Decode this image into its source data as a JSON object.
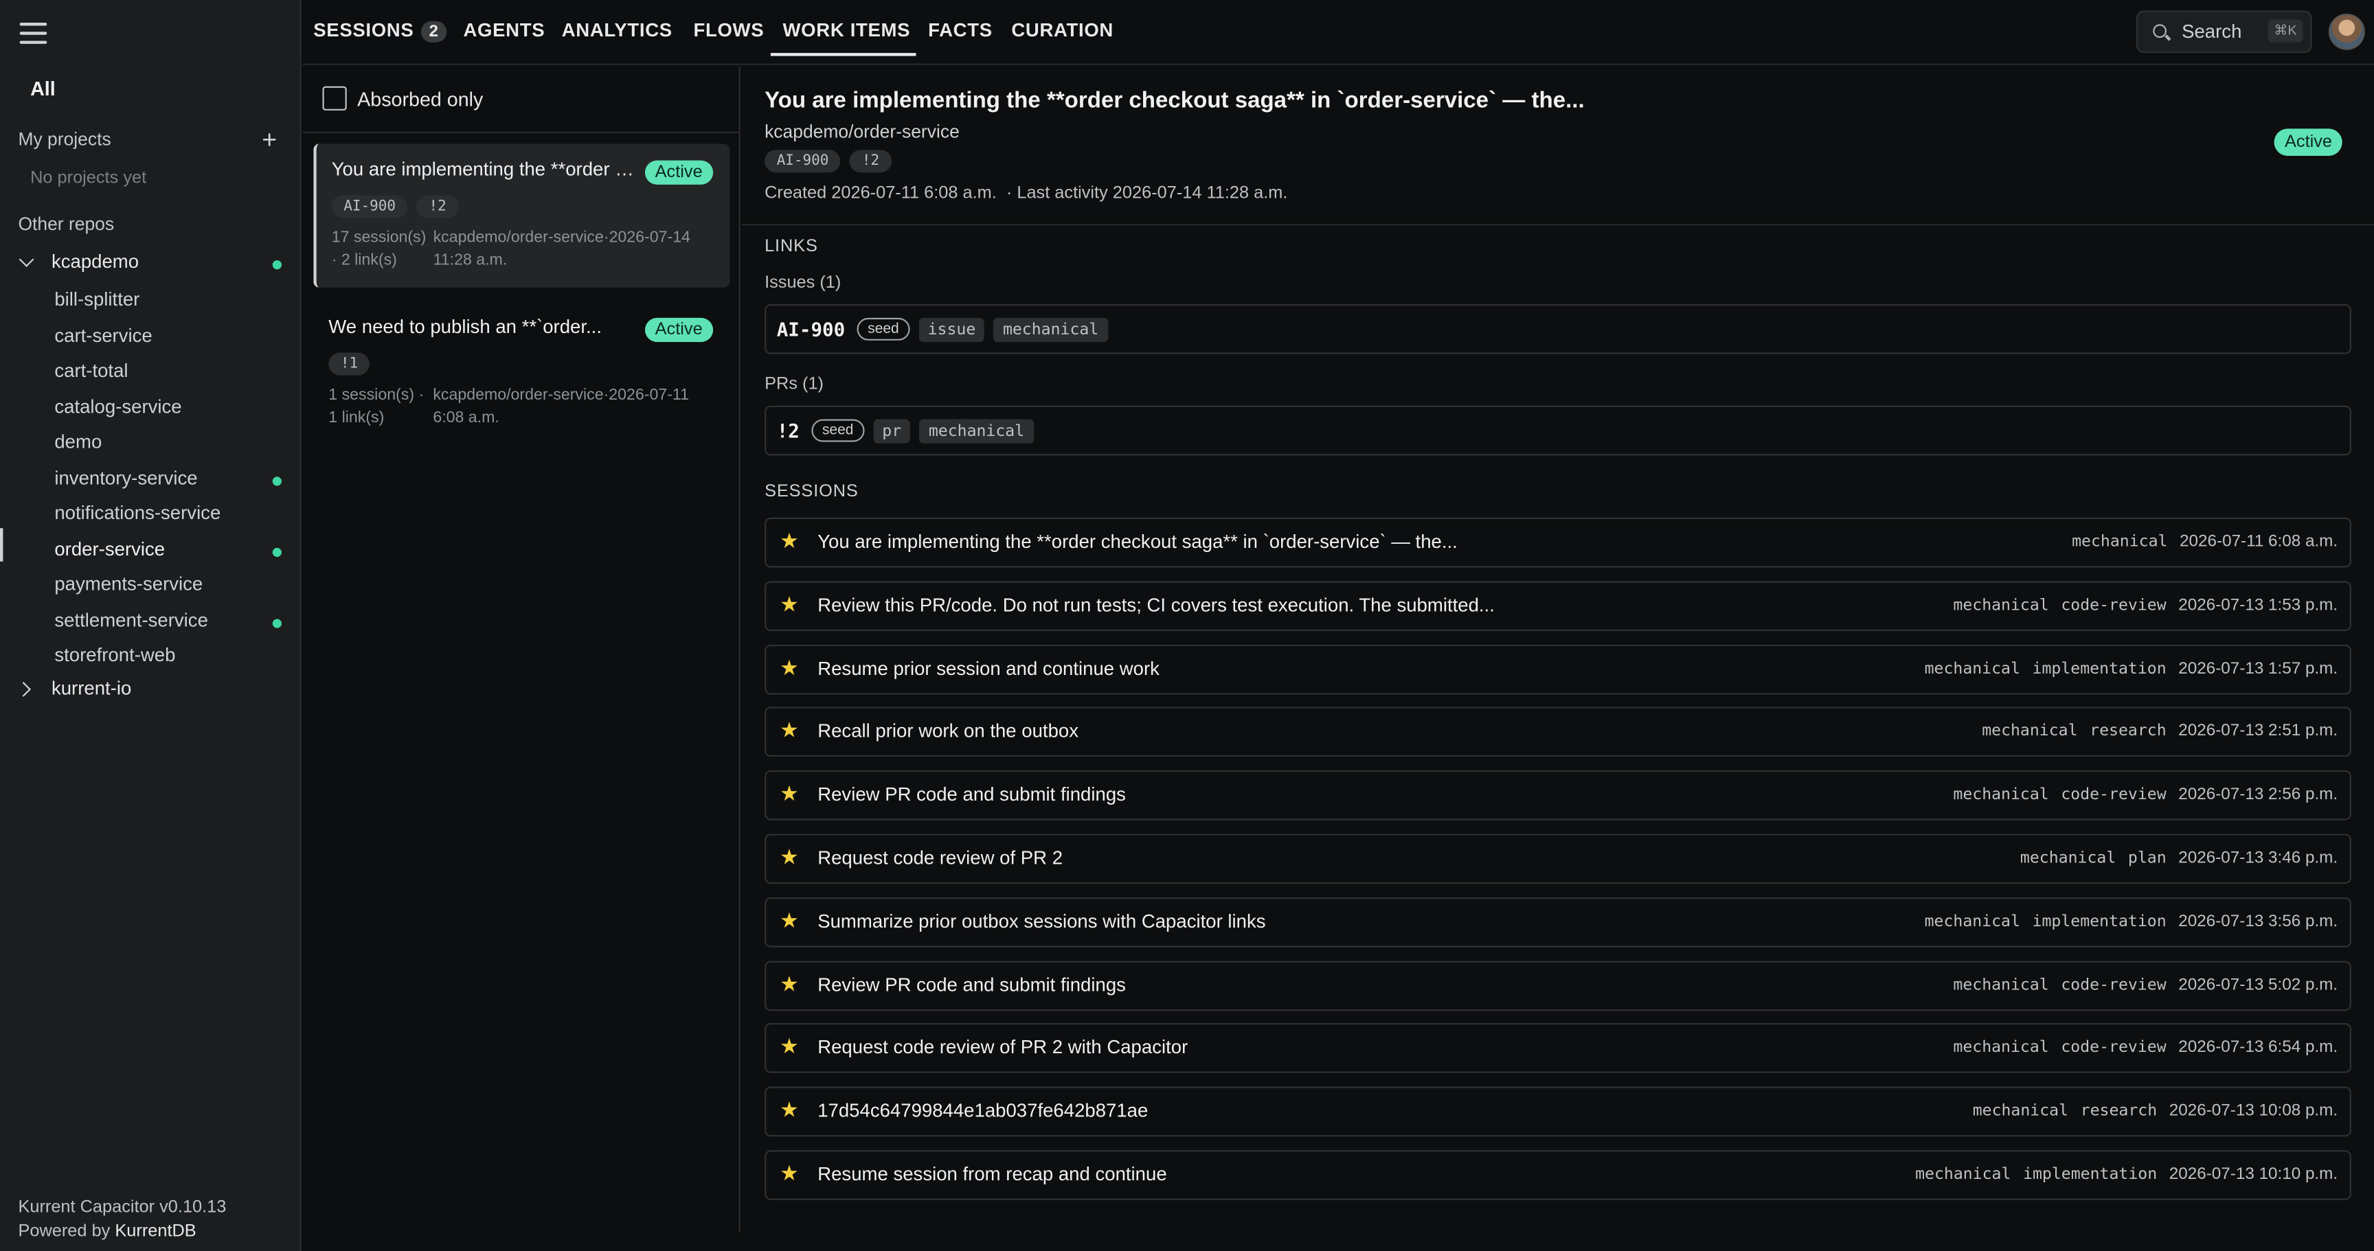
{
  "sidebar": {
    "all_label": "All",
    "my_projects_label": "My projects",
    "no_projects": "No projects yet",
    "other_repos_label": "Other repos",
    "groups": [
      {
        "name": "kcapdemo",
        "expanded": true,
        "has_dot": true
      },
      {
        "name": "kurrent-io",
        "expanded": false,
        "has_dot": false
      }
    ],
    "repos": [
      {
        "name": "bill-splitter",
        "dot": false,
        "active": false
      },
      {
        "name": "cart-service",
        "dot": false,
        "active": false
      },
      {
        "name": "cart-total",
        "dot": false,
        "active": false
      },
      {
        "name": "catalog-service",
        "dot": false,
        "active": false
      },
      {
        "name": "demo",
        "dot": false,
        "active": false
      },
      {
        "name": "inventory-service",
        "dot": true,
        "active": false
      },
      {
        "name": "notifications-service",
        "dot": false,
        "active": false
      },
      {
        "name": "order-service",
        "dot": true,
        "active": true
      },
      {
        "name": "payments-service",
        "dot": false,
        "active": false
      },
      {
        "name": "settlement-service",
        "dot": true,
        "active": false
      },
      {
        "name": "storefront-web",
        "dot": false,
        "active": false
      }
    ],
    "footer_line1": "Kurrent Capacitor v0.10.13",
    "footer_line2_prefix": "Powered by ",
    "footer_line2_link": "KurrentDB"
  },
  "topnav": {
    "tabs": [
      {
        "label": "SESSIONS",
        "count": "2"
      },
      {
        "label": "AGENTS"
      },
      {
        "label": "ANALYTICS"
      },
      {
        "label": "FLOWS"
      },
      {
        "label": "WORK ITEMS",
        "active": true
      },
      {
        "label": "FACTS"
      },
      {
        "label": "CURATION"
      }
    ],
    "search_label": "Search",
    "search_shortcut": "⌘K"
  },
  "filter": {
    "absorbed_only_label": "Absorbed only"
  },
  "work_items": [
    {
      "title": "You are implementing the **order checkout saga** in `order-service` — the...",
      "status": "Active",
      "tags": [
        "AI-900",
        "!2"
      ],
      "meta_left": "17 session(s) · 2 link(s)",
      "meta_right": "kcapdemo/order-service·2026-07-14 11:28 a.m."
    },
    {
      "title": "We need to publish an **`order...",
      "status": "Active",
      "tags": [
        "!1"
      ],
      "meta_left": "1 session(s) · 1 link(s)",
      "meta_right": "kcapdemo/order-service·2026-07-11 6:08 a.m."
    }
  ],
  "detail": {
    "title": "You are implementing the **order checkout saga** in `order-service` — the...",
    "repo": "kcapdemo/order-service",
    "tags": [
      "AI-900",
      "!2"
    ],
    "created": "Created 2026-07-11 6:08 a.m.",
    "last_activity": "· Last activity 2026-07-14 11:28 a.m.",
    "status": "Active",
    "links_heading": "LINKS",
    "issues_heading": "Issues (1)",
    "issue": {
      "id": "AI-900",
      "seed": "seed",
      "kind": "issue",
      "source": "mechanical"
    },
    "prs_heading": "PRs (1)",
    "pr": {
      "id": "!2",
      "seed": "seed",
      "kind": "pr",
      "source": "mechanical"
    },
    "sessions_heading": "SESSIONS",
    "sessions": [
      {
        "title": "You are implementing the **order checkout saga** in `order-service` — the...",
        "tags": [
          "mechanical"
        ],
        "date": "2026-07-11 6:08 a.m."
      },
      {
        "title": "Review this PR/code. Do not run tests; CI covers test execution. The submitted...",
        "tags": [
          "mechanical",
          "code-review"
        ],
        "date": "2026-07-13 1:53 p.m."
      },
      {
        "title": "Resume prior session and continue work",
        "tags": [
          "mechanical",
          "implementation"
        ],
        "date": "2026-07-13 1:57 p.m."
      },
      {
        "title": "Recall prior work on the outbox",
        "tags": [
          "mechanical",
          "research"
        ],
        "date": "2026-07-13 2:51 p.m."
      },
      {
        "title": "Review PR code and submit findings",
        "tags": [
          "mechanical",
          "code-review"
        ],
        "date": "2026-07-13 2:56 p.m."
      },
      {
        "title": "Request code review of PR 2",
        "tags": [
          "mechanical",
          "plan"
        ],
        "date": "2026-07-13 3:46 p.m."
      },
      {
        "title": "Summarize prior outbox sessions with Capacitor links",
        "tags": [
          "mechanical",
          "implementation"
        ],
        "date": "2026-07-13 3:56 p.m."
      },
      {
        "title": "Review PR code and submit findings",
        "tags": [
          "mechanical",
          "code-review"
        ],
        "date": "2026-07-13 5:02 p.m."
      },
      {
        "title": "Request code review of PR 2 with Capacitor",
        "tags": [
          "mechanical",
          "code-review"
        ],
        "date": "2026-07-13 6:54 p.m."
      },
      {
        "title": "17d54c64799844e1ab037fe642b871ae",
        "tags": [
          "mechanical",
          "research"
        ],
        "date": "2026-07-13 10:08 p.m."
      },
      {
        "title": "Resume session from recap and continue",
        "tags": [
          "mechanical",
          "implementation"
        ],
        "date": "2026-07-13 10:10 p.m."
      }
    ]
  },
  "colors": {
    "accent_green": "#5ee3b4",
    "dot_green": "#3fd6a3",
    "star": "#f4d03f"
  }
}
